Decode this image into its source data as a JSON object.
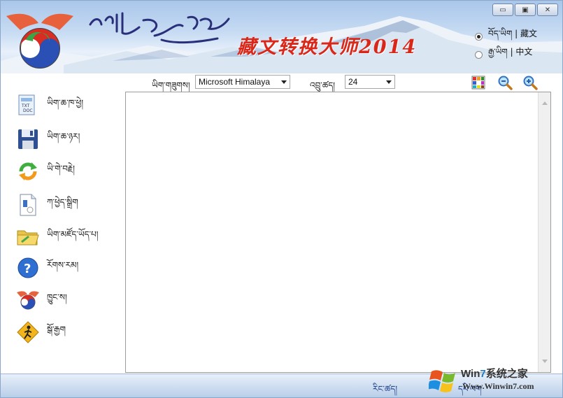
{
  "window": {
    "title_cn": "藏文转换大师2014",
    "title_tibetan": "བོད་ཡིག་བརྗེ་སྒྱུར།",
    "controls": [
      "minimize",
      "maximize",
      "close"
    ]
  },
  "language": {
    "options": [
      {
        "label": "བོད་ཡིག | 藏文",
        "selected": true
      },
      {
        "label": "རྒྱ་ཡིག |  中文",
        "selected": false
      }
    ]
  },
  "toolbar": {
    "font_label": "ཡིག་གཟུགས།",
    "font_value": "Microsoft Himalaya",
    "size_label": "འབྲུ་ཚད།",
    "size_value": "24",
    "icons": [
      "color-grid-icon",
      "zoom-out-icon",
      "zoom-in-icon"
    ]
  },
  "sidebar": {
    "items": [
      {
        "label": "ཡིག་ཆ་ཁ་ཕྱེ།",
        "icon": "open-file-icon"
      },
      {
        "label": "ཡིག་ཆ་ཉར།",
        "icon": "save-icon"
      },
      {
        "label": "ཡི་གེ་བརྗེ།",
        "icon": "convert-icon"
      },
      {
        "label": "ཀ་ཕྱེད་སྒྲིག",
        "icon": "document-icon"
      },
      {
        "label": "ཡིག་མཛོད་ཡོད་པ།",
        "icon": "folder-icon"
      },
      {
        "label": "རོགས་རམ།",
        "icon": "help-icon"
      },
      {
        "label": "ཁྱུང་ས།",
        "icon": "logo-icon"
      },
      {
        "label": "སྒོ་རྒྱག",
        "icon": "exit-icon"
      }
    ]
  },
  "status": {
    "label_left": "རིང་ཚད།",
    "label_right": "དཔེ་ལག"
  },
  "watermark": {
    "title_part1": "Win",
    "title_part2": "7",
    "title_part3": "系统之家",
    "url": "Www.Winwin7.com"
  },
  "colors": {
    "accent": "#d9271a",
    "banner_sky": "#a9c6ea",
    "status_text": "#1b3d87"
  }
}
